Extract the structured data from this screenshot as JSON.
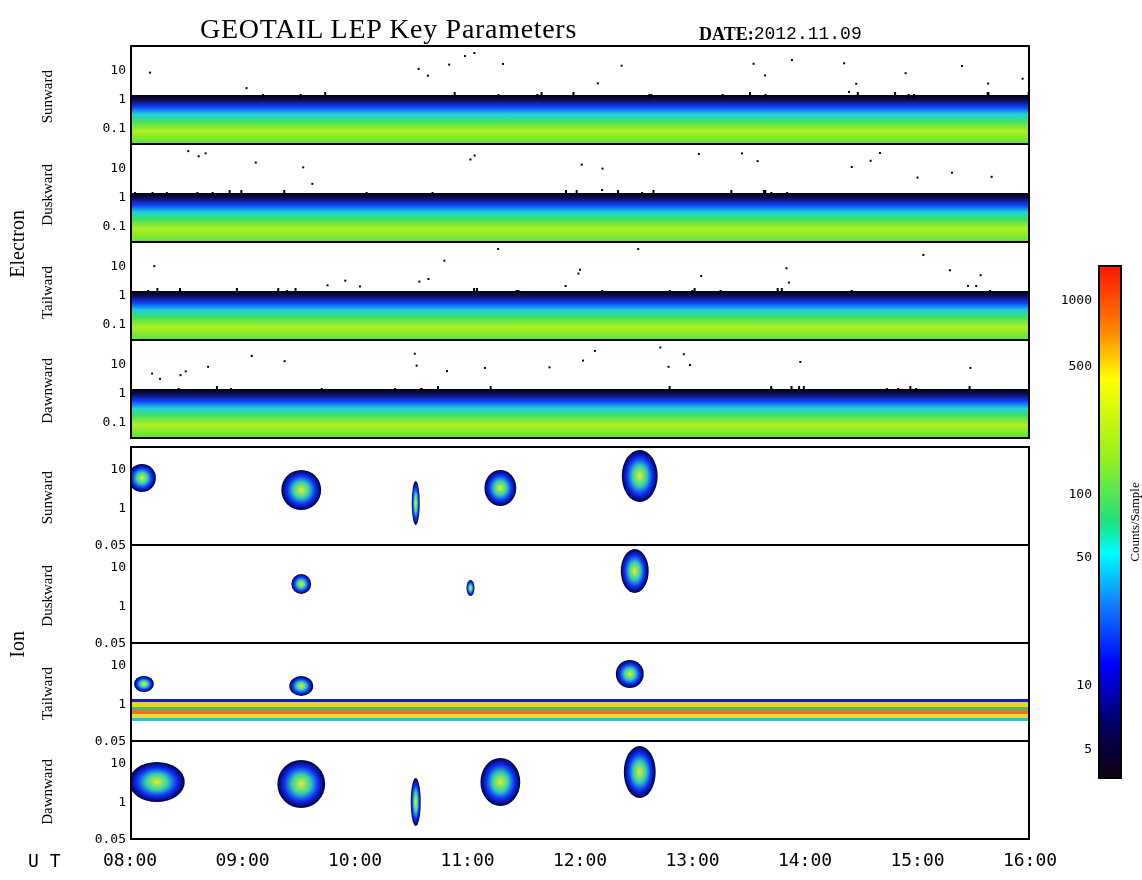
{
  "title": "GEOTAIL LEP Key Parameters",
  "date": {
    "label": "DATE:",
    "value": "2012.11.09"
  },
  "groups": [
    {
      "label": "Electron",
      "kind": "electron",
      "panels": [
        {
          "label": "Sunward",
          "yticks": [
            "10",
            "1",
            "0.1"
          ]
        },
        {
          "label": "Duskward",
          "yticks": [
            "10",
            "1",
            "0.1"
          ]
        },
        {
          "label": "Tailward",
          "yticks": [
            "10",
            "1",
            "0.1"
          ]
        },
        {
          "label": "Dawnward",
          "yticks": [
            "10",
            "1",
            "0.1"
          ]
        }
      ]
    },
    {
      "label": "Ion",
      "kind": "ion",
      "panels": [
        {
          "label": "Sunward",
          "yticks": [
            "10",
            "1",
            "0.05"
          ]
        },
        {
          "label": "Duskward",
          "yticks": [
            "10",
            "1",
            "0.05"
          ]
        },
        {
          "label": "Tailward",
          "yticks": [
            "10",
            "1",
            "0.05"
          ]
        },
        {
          "label": "Dawnward",
          "yticks": [
            "10",
            "1",
            "0.05"
          ]
        }
      ]
    }
  ],
  "x_axis": {
    "label": "U T",
    "ticks": [
      "08:00",
      "09:00",
      "10:00",
      "11:00",
      "12:00",
      "13:00",
      "14:00",
      "15:00",
      "16:00"
    ]
  },
  "colorbar": {
    "label": "Counts/Sample",
    "ticks": [
      "1000",
      "500",
      "100",
      "50",
      "10",
      "5"
    ]
  }
}
